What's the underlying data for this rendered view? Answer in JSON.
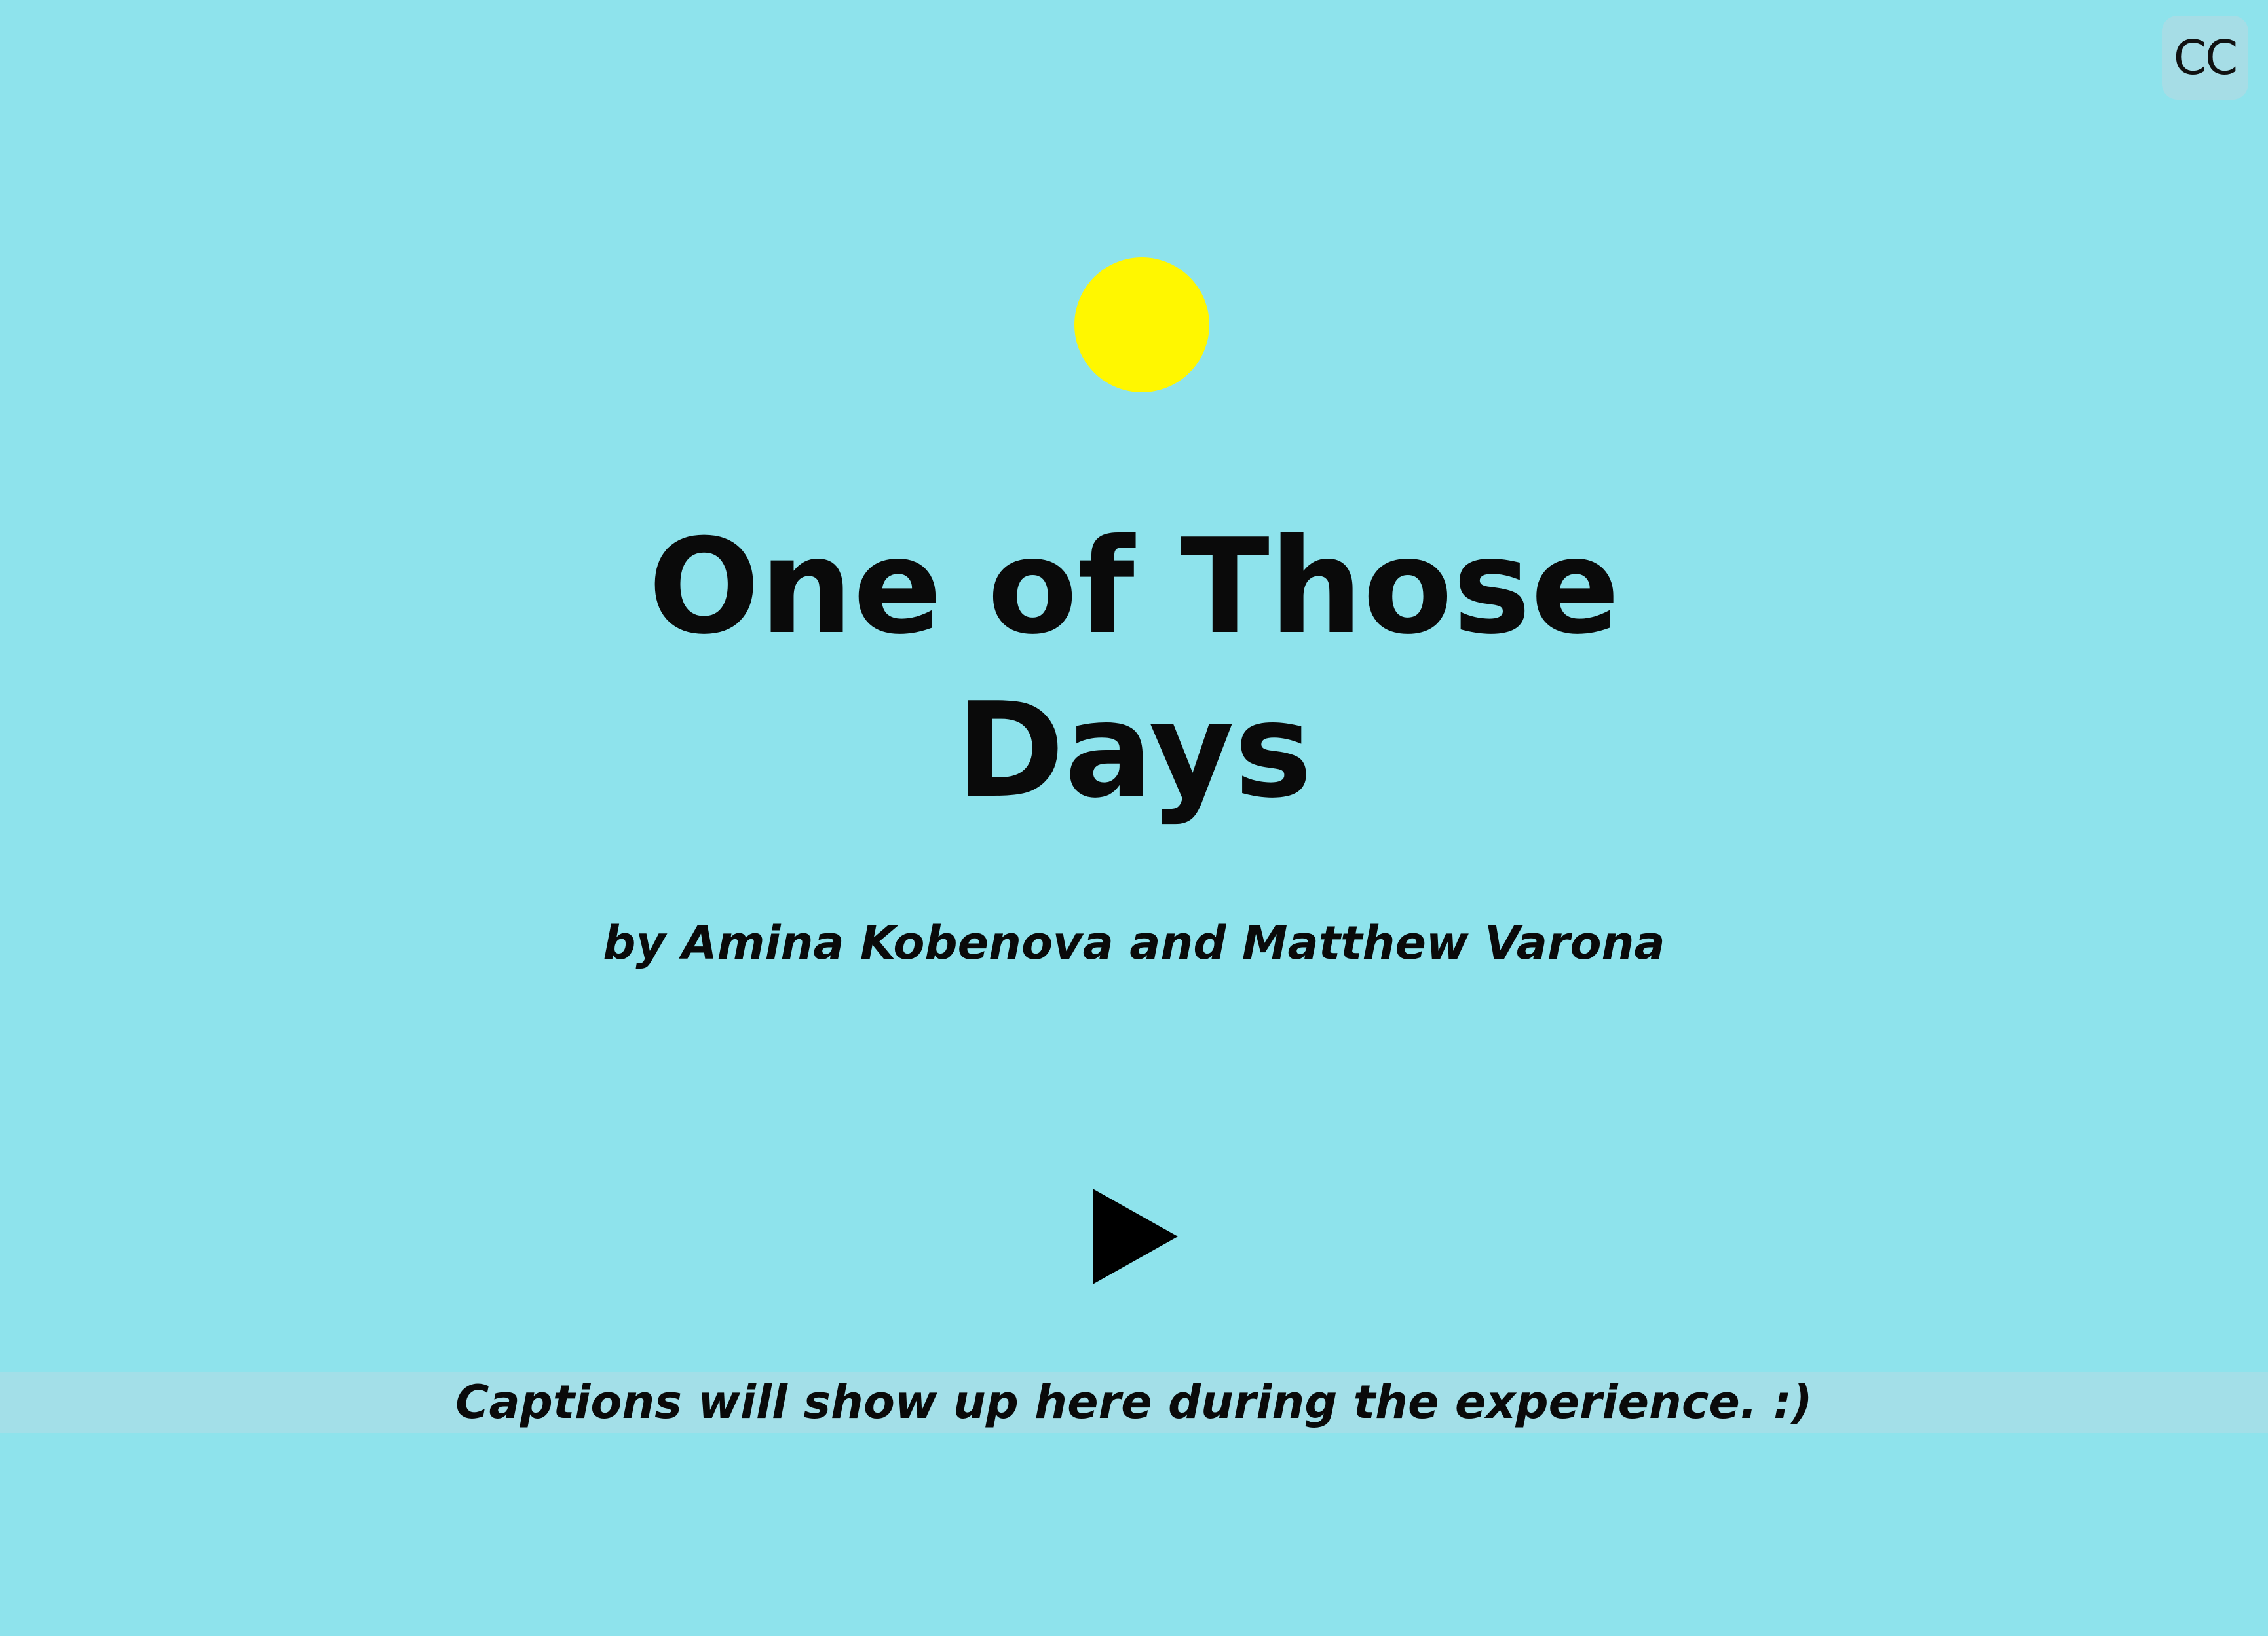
{
  "cc_button": {
    "label": "CC"
  },
  "title": {
    "line1": "One of Those",
    "line2": "Days"
  },
  "byline": "by Amina Kobenova and Matthew Varona",
  "play_button": {
    "icon": "play-icon"
  },
  "captions": {
    "text": "Captions will show up here during the experience. :)"
  },
  "colors": {
    "background": "#8ee3ec",
    "sun": "#fff700",
    "caption_bar": "#a3dfe8",
    "cc_button_bg": "#a6dde6",
    "text": "#0a0a0a"
  }
}
